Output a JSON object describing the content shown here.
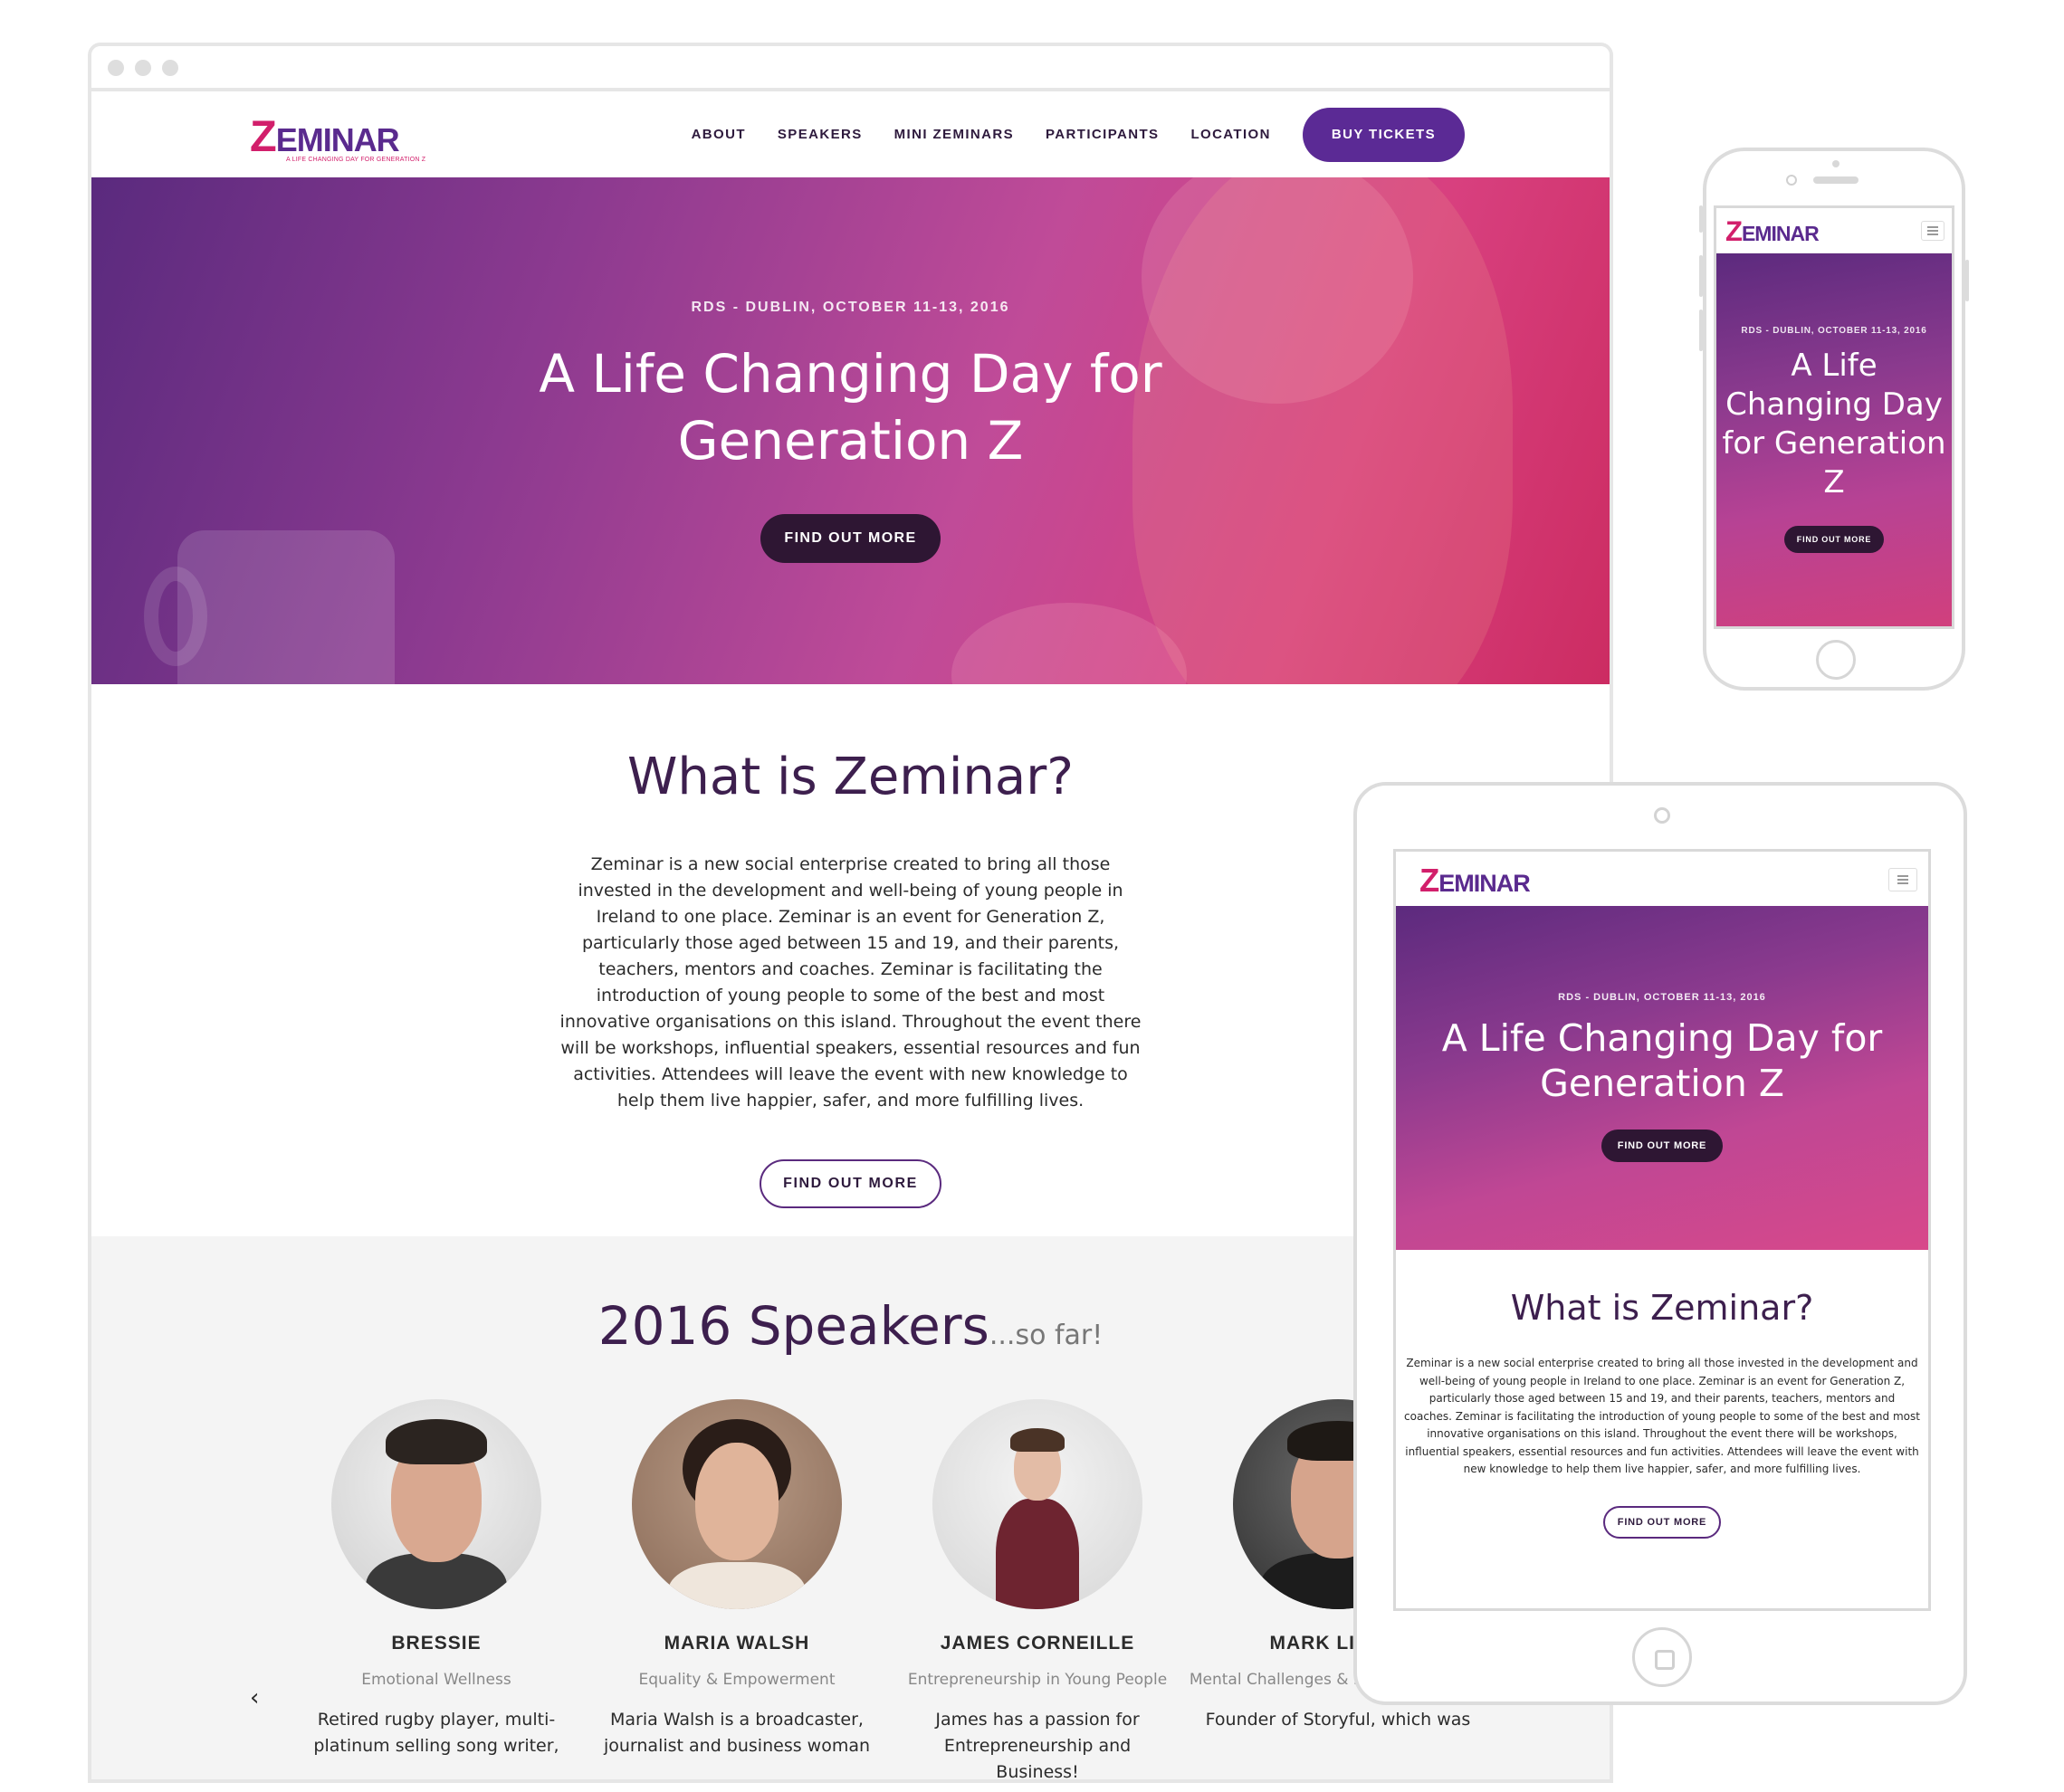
{
  "brand": {
    "logo_text": "EMINAR",
    "logo_initial": "Z",
    "tagline": "A LIFE CHANGING DAY FOR GENERATION Z",
    "primary_color": "#5b2a95",
    "accent_color": "#d21f6b",
    "dark_button_color": "#2e1633"
  },
  "nav": {
    "items": [
      {
        "label": "ABOUT"
      },
      {
        "label": "SPEAKERS"
      },
      {
        "label": "MINI ZEMINARS"
      },
      {
        "label": "PARTICIPANTS"
      },
      {
        "label": "LOCATION"
      }
    ],
    "cta_label": "BUY TICKETS",
    "menu_icon": "hamburger-icon"
  },
  "hero": {
    "kicker": "RDS - DUBLIN, OCTOBER 11-13, 2016",
    "title": "A Life Changing Day for Generation Z",
    "button_label": "FIND OUT MORE"
  },
  "about": {
    "heading": "What is Zeminar?",
    "body": "Zeminar is a new social enterprise created to bring all those invested in the development and well-being of young people in Ireland to one place. Zeminar is an event for Generation Z, particularly those aged between 15 and 19, and their parents, teachers, mentors and coaches. Zeminar is facilitating the introduction of young people to some of the best and most innovative organisations on this island. Throughout the event there will be workshops, influential speakers, essential resources and fun activities. Attendees will leave the event with new knowledge to help them live happier, safer, and more fulfilling lives.",
    "button_label": "FIND OUT MORE"
  },
  "speakers": {
    "heading": "2016 Speakers",
    "heading_suffix": "...so far!",
    "prev_icon": "chevron-left-icon",
    "next_icon": "chevron-right-icon",
    "items": [
      {
        "name": "BRESSIE",
        "role": "Emotional Wellness",
        "desc": "Retired rugby player, multi-platinum selling song writer,"
      },
      {
        "name": "MARIA WALSH",
        "role": "Equality & Empowerment",
        "desc": "Maria Walsh is a broadcaster, journalist and business woman"
      },
      {
        "name": "JAMES CORNEILLE",
        "role": "Entrepreneurship in Young People",
        "desc": "James has a passion for Entrepreneurship and Business!"
      },
      {
        "name": "MARK LITTLE",
        "role": "Mental Challenges & Entrepreneurship",
        "desc": "Founder of Storyful, which was"
      }
    ]
  }
}
